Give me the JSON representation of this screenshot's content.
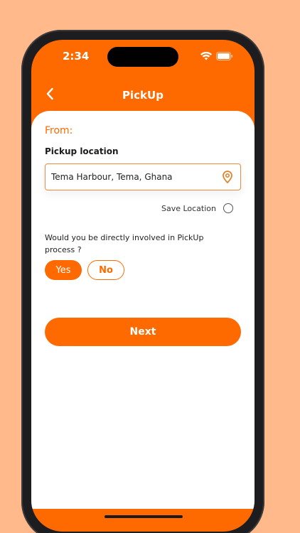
{
  "status_bar": {
    "time": "2:34"
  },
  "header": {
    "title": "PickUp",
    "back_icon": "chevron-left-icon"
  },
  "form": {
    "section_title": "From:",
    "pickup_label": "Pickup location",
    "pickup_value": "Tema Harbour, Tema, Ghana",
    "pin_icon": "map-pin-icon",
    "save_location_label": "Save Location",
    "save_location_checked": false,
    "question": "Would you be directly involved in PickUp process ?",
    "options": [
      {
        "label": "Yes",
        "selected": true
      },
      {
        "label": "No",
        "selected": false
      }
    ],
    "next_label": "Next"
  },
  "colors": {
    "accent": "#FF6A00",
    "background": "#FFB98A",
    "input_border": "#F28A3C"
  }
}
